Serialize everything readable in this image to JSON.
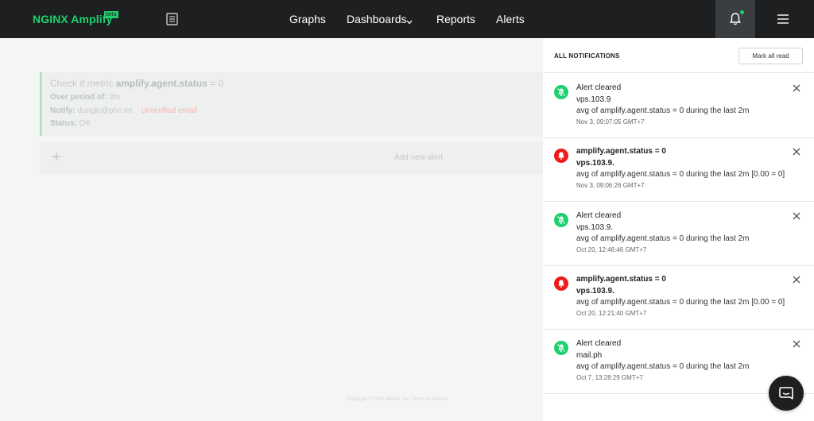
{
  "nav": {
    "brand": "NGINX Amplify",
    "beta": "beta",
    "items": [
      {
        "label": "Graphs"
      },
      {
        "label": "Dashboards"
      },
      {
        "label": "Reports"
      },
      {
        "label": "Alerts"
      }
    ],
    "icons": [
      "document-icon",
      "chevron-down-icon",
      "bell-icon",
      "menu-icon"
    ]
  },
  "background": {
    "alert": {
      "prefix": "Check if metric",
      "metric": "amplify.agent.status",
      "condition": "= 0",
      "period_label": "Over period of:",
      "period_value": "2m",
      "notify_label": "Notify:",
      "notify_value": "dunglc@phc.vn",
      "unverified": "unverified email",
      "status_label": "Status:",
      "status_value": "OK"
    },
    "add_alert": "Add new alert",
    "footer": "Copyright © 2019 NGINX, Inc.  Terms of Service"
  },
  "panel": {
    "title": "ALL NOTIFICATIONS",
    "mark_all": "Mark all read",
    "notifications": [
      {
        "type": "cleared",
        "title": "Alert cleared",
        "host": "vps.103.9",
        "desc": "avg of amplify.agent.status = 0 during the last 2m",
        "time": "Nov 3, 09:07:05 GMT+7"
      },
      {
        "type": "alert",
        "title": "amplify.agent.status = 0",
        "host": "vps.103.9.",
        "desc": "avg of amplify.agent.status = 0 during the last 2m [0.00 = 0]",
        "time": "Nov 3, 09:06:26 GMT+7"
      },
      {
        "type": "cleared",
        "title": "Alert cleared",
        "host": "vps.103.9.",
        "desc": "avg of amplify.agent.status = 0 during the last 2m",
        "time": "Oct 20, 12:46:46 GMT+7"
      },
      {
        "type": "alert",
        "title": "amplify.agent.status = 0",
        "host": "vps.103.9.",
        "desc": "avg of amplify.agent.status = 0 during the last 2m [0.00 = 0]",
        "time": "Oct 20, 12:21:40 GMT+7"
      },
      {
        "type": "cleared",
        "title": "Alert cleared",
        "host": "mail.ph",
        "desc": "avg of amplify.agent.status = 0 during the last 2m",
        "time": "Oct 7, 13:28:29 GMT+7"
      }
    ]
  },
  "colors": {
    "brand_green": "#1fd16e",
    "alert_red": "#ee1c1c",
    "nav_bg": "#1d1f20"
  }
}
